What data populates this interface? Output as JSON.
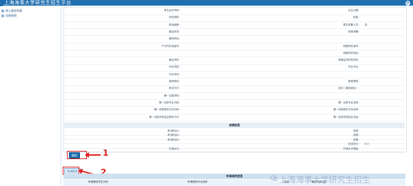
{
  "header": {
    "title": "上海海事大学研究生招生平台"
  },
  "sidebar": {
    "items": [
      {
        "label": "网上报名申请"
      },
      {
        "label": "注册须知"
      }
    ]
  },
  "form": {
    "rows": [
      {
        "left": "考生证件号码：",
        "right": "出生日期：",
        "right_value": ""
      },
      {
        "left": "所在院校：",
        "right": "民族：",
        "right_value": ""
      },
      {
        "left": "政治面貌：",
        "right": "是否军籍人员：",
        "right_value": "否"
      },
      {
        "left": "婚否状况：",
        "right": "现役军籍：",
        "right_value": ""
      },
      {
        "left": "通讯地址：",
        "right": "",
        "right_value": ""
      },
      {
        "left": "户口所在地省市：",
        "right": "档案所在省市：",
        "right_value": ""
      },
      {
        "left": "",
        "right": "档案所在地址：",
        "right_value": ""
      },
      {
        "left": "最后学历：",
        "right": "获最后学历的学校：",
        "right_value": ""
      },
      {
        "left": "毕业学校：",
        "right": "毕业专业：",
        "right_value": ""
      },
      {
        "left": "毕业年份：",
        "right": "",
        "right_value": ""
      },
      {
        "left": "报考单位：",
        "right": "报考类别：",
        "right_value": ""
      },
      {
        "left": "考试方式：",
        "right": "定向（委培单位）：",
        "right_value": ""
      },
      {
        "left": "第一志愿学科：",
        "right": "",
        "right_value": ""
      },
      {
        "left": "第一志愿专业代码：",
        "right": "第一志愿专业名称：",
        "right_value": ""
      },
      {
        "left": "第一志愿研究方向代码：",
        "right": "第一志愿研究方向名称：",
        "right_value": ""
      },
      {
        "left": "第一志愿学校招生联系方式：",
        "right": "第一志愿学校招生电话：",
        "right_value": ""
      }
    ],
    "section_title": "成绩信息",
    "rows2": [
      {
        "left": "考试科目1：",
        "right": "成绩：",
        "right_value": ""
      },
      {
        "left": "考试科目2：",
        "right": "成绩：",
        "right_value": ""
      },
      {
        "left": "考试科目3：",
        "right": "成绩：",
        "right_value": ""
      },
      {
        "left": "",
        "right": "初试总分：",
        "right_value": "0.0"
      },
      {
        "left": "外语水平：",
        "right": "外语水平等级：",
        "right_value": ""
      }
    ]
  },
  "buttons": {
    "confirm": "确定",
    "submit": "完成报名"
  },
  "annotations": {
    "one": "1",
    "two": "2"
  },
  "bottom": {
    "title": "申请调剂信息",
    "cols": [
      "申请调剂学生代码",
      "申请调剂专业名称",
      "状态",
      "确认时间以后"
    ]
  },
  "watermark": {
    "text": "上海海事大学研究生招生"
  },
  "colors": {
    "brand": "#1f6fb0",
    "annotation": "#e02020"
  }
}
